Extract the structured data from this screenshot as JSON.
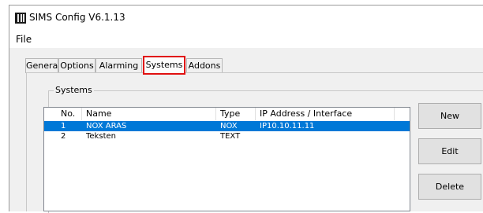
{
  "window": {
    "title": "SIMS Config V6.1.13"
  },
  "menu": {
    "file": "File"
  },
  "tabs": [
    {
      "label": "General"
    },
    {
      "label": "Options"
    },
    {
      "label": "Alarming"
    },
    {
      "label": "Systems"
    },
    {
      "label": "Addons"
    }
  ],
  "active_tab": "Systems",
  "systems_group": {
    "label": "Systems",
    "columns": [
      "No.",
      "Name",
      "Type",
      "IP Address / Interface"
    ],
    "rows": [
      {
        "no": "1",
        "name": "NOX ARAS",
        "type": "NOX",
        "ip": "IP10.10.11.11",
        "selected": true
      },
      {
        "no": "2",
        "name": "Teksten",
        "type": "TEXT",
        "ip": "",
        "selected": false
      }
    ]
  },
  "buttons": {
    "new": "New",
    "edit": "Edit",
    "delete": "Delete"
  },
  "colors": {
    "selection": "#0078d7",
    "tab_highlight": "#e01010"
  }
}
